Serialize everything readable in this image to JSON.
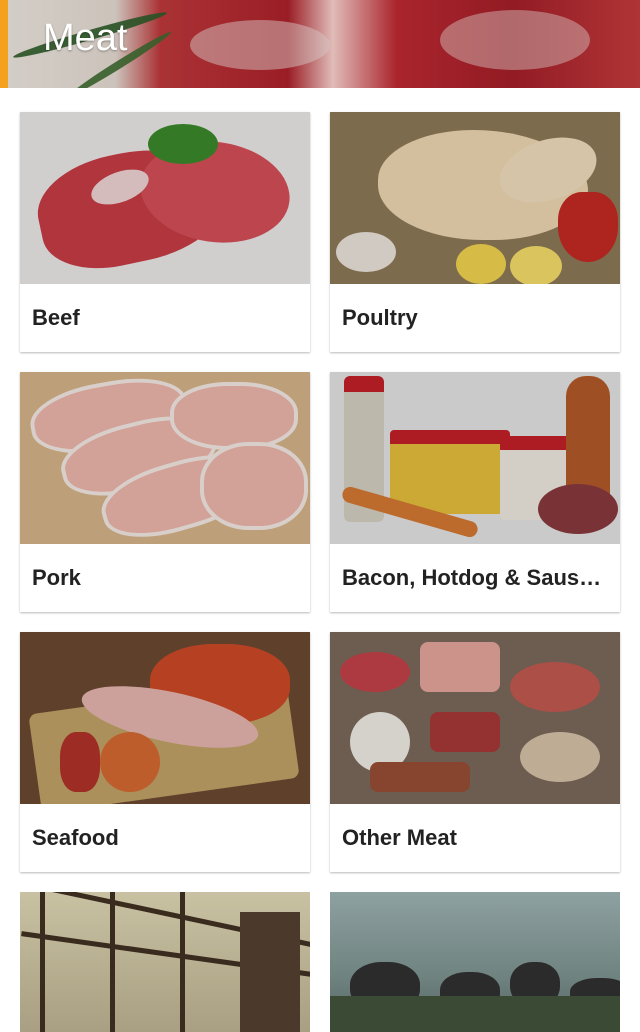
{
  "header": {
    "title": "Meat"
  },
  "categories": [
    {
      "label": "Beef"
    },
    {
      "label": "Poultry"
    },
    {
      "label": "Pork"
    },
    {
      "label": "Bacon, Hotdog & Sausage"
    },
    {
      "label": "Seafood"
    },
    {
      "label": "Other Meat"
    }
  ],
  "colors": {
    "accent": "#f4a11e",
    "header_text": "#ffffff",
    "label_text": "#222222"
  }
}
